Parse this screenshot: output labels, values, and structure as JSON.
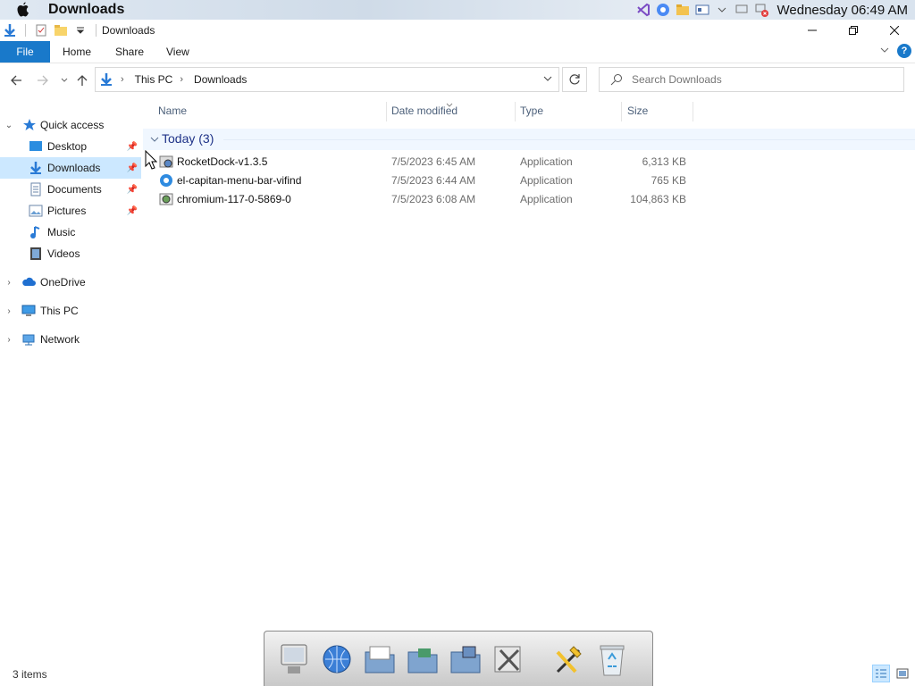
{
  "menubar": {
    "title": "Downloads",
    "clock": "Wednesday 06:49 AM"
  },
  "titlebar": {
    "title": "Downloads"
  },
  "ribbon": {
    "tabs": [
      "File",
      "Home",
      "Share",
      "View"
    ]
  },
  "address": {
    "crumbs": [
      "This PC",
      "Downloads"
    ]
  },
  "search": {
    "placeholder": "Search Downloads"
  },
  "navpane": {
    "quick_access": "Quick access",
    "items": [
      {
        "label": "Desktop",
        "icon": "desktop-icon",
        "pinned": true
      },
      {
        "label": "Downloads",
        "icon": "download-icon",
        "pinned": true,
        "selected": true
      },
      {
        "label": "Documents",
        "icon": "documents-icon",
        "pinned": true
      },
      {
        "label": "Pictures",
        "icon": "pictures-icon",
        "pinned": true
      },
      {
        "label": "Music",
        "icon": "music-icon",
        "pinned": false
      },
      {
        "label": "Videos",
        "icon": "videos-icon",
        "pinned": false
      }
    ],
    "onedrive": "OneDrive",
    "thispc": "This PC",
    "network": "Network"
  },
  "columns": {
    "name": "Name",
    "date": "Date modified",
    "type": "Type",
    "size": "Size"
  },
  "group": {
    "label": "Today (3)"
  },
  "files": [
    {
      "name": "RocketDock-v1.3.5",
      "date": "7/5/2023 6:45 AM",
      "type": "Application",
      "size": "6,313 KB"
    },
    {
      "name": "el-capitan-menu-bar-vifind",
      "date": "7/5/2023 6:44 AM",
      "type": "Application",
      "size": "765 KB"
    },
    {
      "name": "chromium-117-0-5869-0",
      "date": "7/5/2023 6:08 AM",
      "type": "Application",
      "size": "104,863 KB"
    }
  ],
  "status": {
    "count": "3 items"
  },
  "colors": {
    "accent": "#1979ca",
    "selection": "#cce8ff",
    "group_text": "#1e3287"
  }
}
